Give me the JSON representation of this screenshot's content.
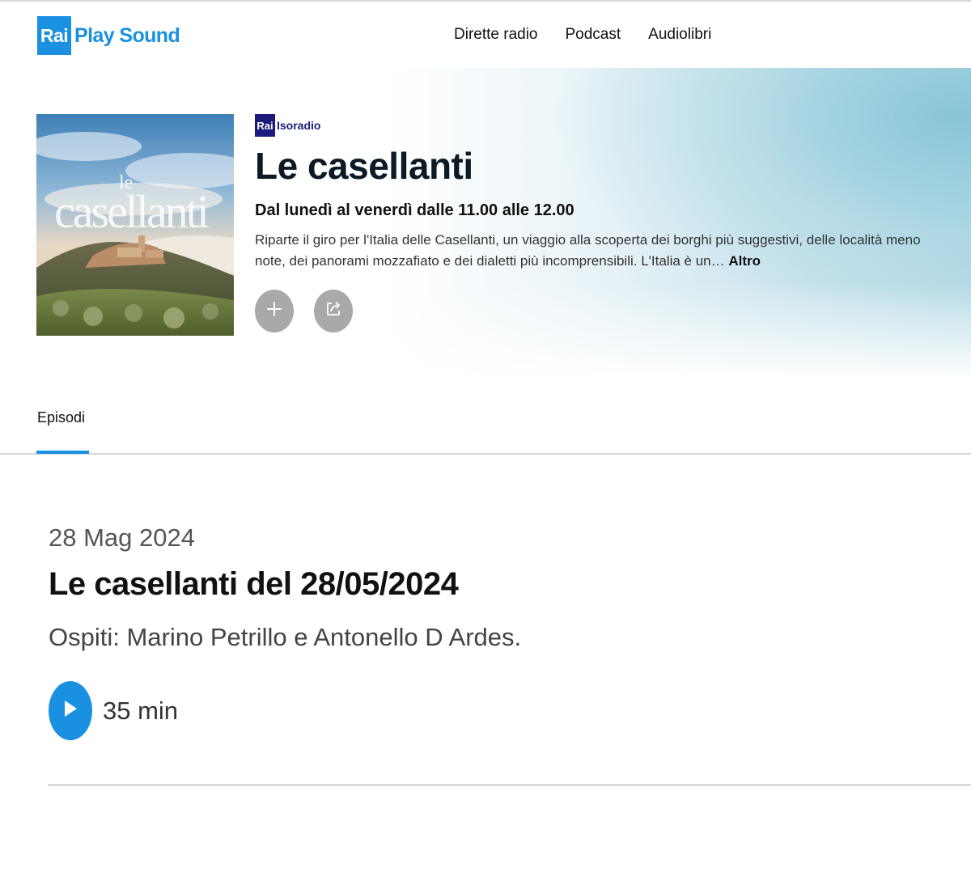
{
  "header": {
    "logo_rai": "Rai",
    "logo_text": "Play Sound",
    "nav": [
      "Dirette radio",
      "Podcast",
      "Audiolibri"
    ]
  },
  "program": {
    "channel_rai": "Rai",
    "channel_name": "Isoradio",
    "cover_text_top": "le",
    "cover_text_main": "casellanti",
    "title": "Le casellanti",
    "schedule": "Dal lunedì al venerdì dalle 11.00 alle 12.00",
    "description": "Riparte il giro per l'Italia delle Casellanti, un viaggio alla scoperta dei borghi più suggestivi, delle località meno note, dei panorami mozzafiato e dei dialetti più incomprensibili. L'Italia è un…",
    "more_label": "Altro",
    "actions": {
      "add_icon": "plus-icon",
      "share_icon": "share-icon"
    }
  },
  "tabs": [
    {
      "label": "Episodi",
      "active": true
    }
  ],
  "episodes": [
    {
      "date": "28 Mag 2024",
      "title": "Le casellanti del 28/05/2024",
      "description": "Ospiti: Marino Petrillo e Antonello D Ardes.",
      "duration": "35 min",
      "play_icon": "play-icon"
    }
  ],
  "colors": {
    "accent": "#1a90e0",
    "isoradio": "#1b1b7e",
    "action_button": "#a9a9a9"
  }
}
